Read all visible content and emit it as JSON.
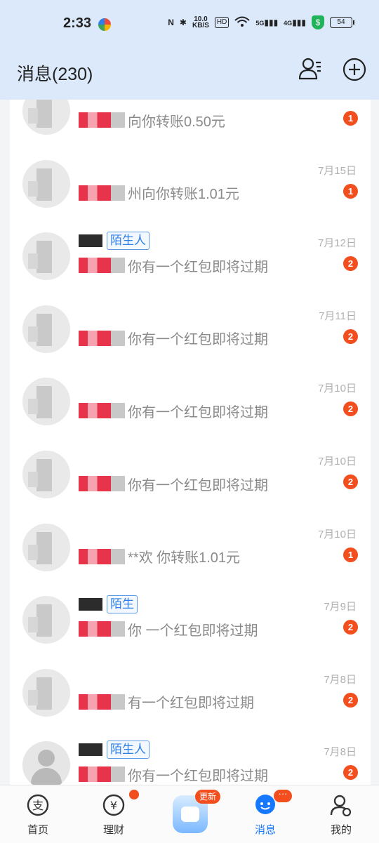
{
  "status_bar": {
    "time": "2:33",
    "network_speed": "10.0\nKB/S",
    "battery": "54",
    "signal_labels": [
      "5G",
      "4G"
    ],
    "hd_label": "HD"
  },
  "header": {
    "title": "消息(230)"
  },
  "messages": [
    {
      "date": "",
      "tag": "",
      "text": "向你转账0.50元",
      "badge": "1"
    },
    {
      "date": "7月15日",
      "tag": "",
      "text": "州向你转账1.01元",
      "badge": "1"
    },
    {
      "date": "7月12日",
      "tag": "陌生人",
      "text": "你有一个红包即将过期",
      "badge": "2"
    },
    {
      "date": "7月11日",
      "tag": "",
      "text": "你有一个红包即将过期",
      "badge": "2"
    },
    {
      "date": "7月10日",
      "tag": "",
      "text": "你有一个红包即将过期",
      "badge": "2"
    },
    {
      "date": "7月10日",
      "tag": "",
      "text": "你有一个红包即将过期",
      "badge": "2"
    },
    {
      "date": "7月10日",
      "tag": "",
      "text": "**欢 你转账1.01元",
      "badge": "1"
    },
    {
      "date": "7月9日",
      "tag": "陌生",
      "text": "你 一个红包即将过期",
      "badge": "2"
    },
    {
      "date": "7月8日",
      "tag": "",
      "text": "有一个红包即将过期",
      "badge": "2"
    },
    {
      "date": "7月8日",
      "tag": "陌生人",
      "text": "你有一个红包即将过期",
      "badge": "2"
    }
  ],
  "bottom_nav": {
    "items": [
      {
        "label": "首页",
        "icon": "home-alipay-icon"
      },
      {
        "label": "理财",
        "icon": "yuan-icon"
      },
      {
        "label": "",
        "icon": "center-assistant-icon"
      },
      {
        "label": "消息",
        "icon": "message-icon"
      },
      {
        "label": "我的",
        "icon": "profile-icon"
      }
    ],
    "center_badge": "更新",
    "message_badge": "···"
  },
  "colors": {
    "header_bg": "#dbe9fb",
    "accent": "#1677ff",
    "badge": "#f24e1e",
    "tag": "#2f7fe8"
  }
}
